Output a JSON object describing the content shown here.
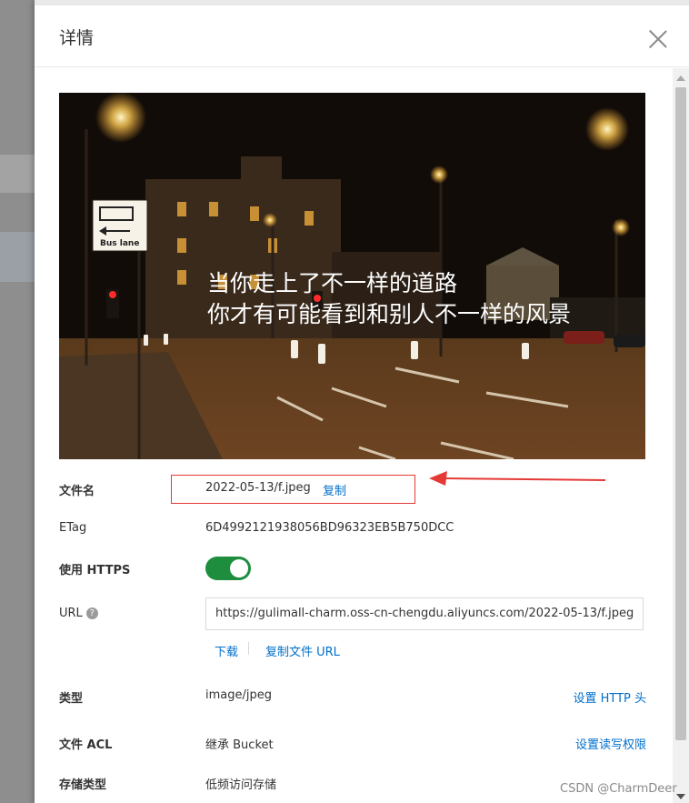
{
  "drawer": {
    "title": "详情"
  },
  "fields": {
    "filename": {
      "label": "文件名",
      "value": "2022-05-13/f.jpeg",
      "copy_label": "复制"
    },
    "etag": {
      "label": "ETag",
      "value": "6D4992121938056BD96323EB5B750DCC"
    },
    "https": {
      "label": "使用 HTTPS",
      "enabled": true
    },
    "url": {
      "label": "URL",
      "help_icon": "question-circle-icon",
      "value": "https://gulimall-charm.oss-cn-chengdu.aliyuncs.com/2022-05-13/f.jpeg",
      "download_label": "下载",
      "copy_url_label": "复制文件 URL"
    },
    "type": {
      "label": "类型",
      "value": "image/jpeg",
      "action_label": "设置 HTTP 头"
    },
    "acl": {
      "label": "文件 ACL",
      "value": "继承 Bucket",
      "action_label": "设置读写权限"
    },
    "storage": {
      "label": "存储类型",
      "value": "低频访问存储"
    }
  },
  "preview": {
    "sign_text": "Bus lane",
    "caption_line1": "当你走上了不一样的道路",
    "caption_line2": "你才有可能看到和别人不一样的风景"
  },
  "watermark": "CSDN @CharmDeer",
  "colors": {
    "toggle_on": "#1e8e3e",
    "link": "#0070cc",
    "highlight_box": "#e53935"
  }
}
